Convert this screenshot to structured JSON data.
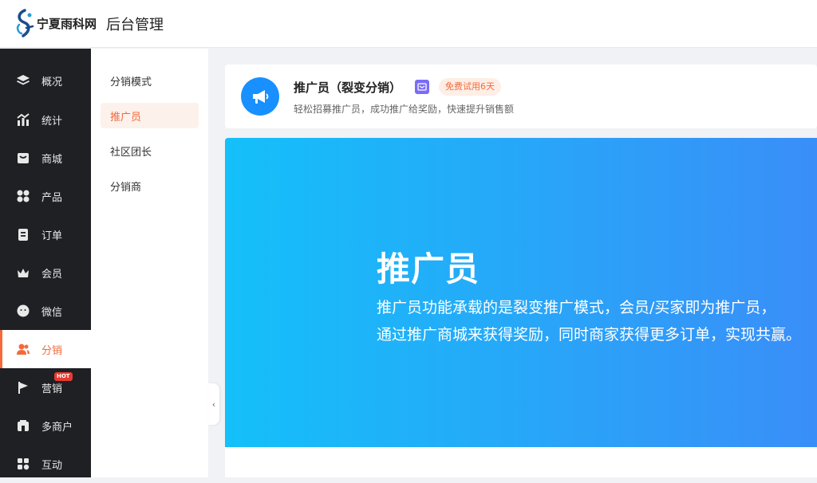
{
  "header": {
    "logo_text": "宁夏雨科网",
    "title": "后台管理"
  },
  "sidebar": {
    "items": [
      {
        "label": "概况",
        "icon": "layers-icon"
      },
      {
        "label": "统计",
        "icon": "chart-icon"
      },
      {
        "label": "商城",
        "icon": "store-icon"
      },
      {
        "label": "产品",
        "icon": "grid-icon"
      },
      {
        "label": "订单",
        "icon": "clipboard-icon"
      },
      {
        "label": "会员",
        "icon": "crown-icon"
      },
      {
        "label": "微信",
        "icon": "chat-icon"
      },
      {
        "label": "分销",
        "icon": "users-icon",
        "active": true
      },
      {
        "label": "营销",
        "icon": "flag-icon",
        "badge": "HOT"
      },
      {
        "label": "多商户",
        "icon": "shop-icon"
      },
      {
        "label": "互动",
        "icon": "apps-icon"
      }
    ]
  },
  "subnav": {
    "items": [
      {
        "label": "分销模式"
      },
      {
        "label": "推广员",
        "active": true
      },
      {
        "label": "社区团长"
      },
      {
        "label": "分销商"
      }
    ]
  },
  "info_card": {
    "title": "推广员（裂变分销）",
    "trial_badge": "免费试用6天",
    "description": "轻松招募推广员，成功推广给奖励，快速提升销售额"
  },
  "banner": {
    "title": "推广员",
    "line1": "推广员功能承载的是裂变推广模式，会员/买家即为推广员，",
    "line2": "通过推广商城来获得奖励，同时商家获得更多订单，实现共赢。"
  },
  "colors": {
    "accent": "#f46a3b",
    "sidebar_bg": "#1f2024",
    "banner_start": "#14c0f9",
    "banner_end": "#3a8ef8"
  }
}
